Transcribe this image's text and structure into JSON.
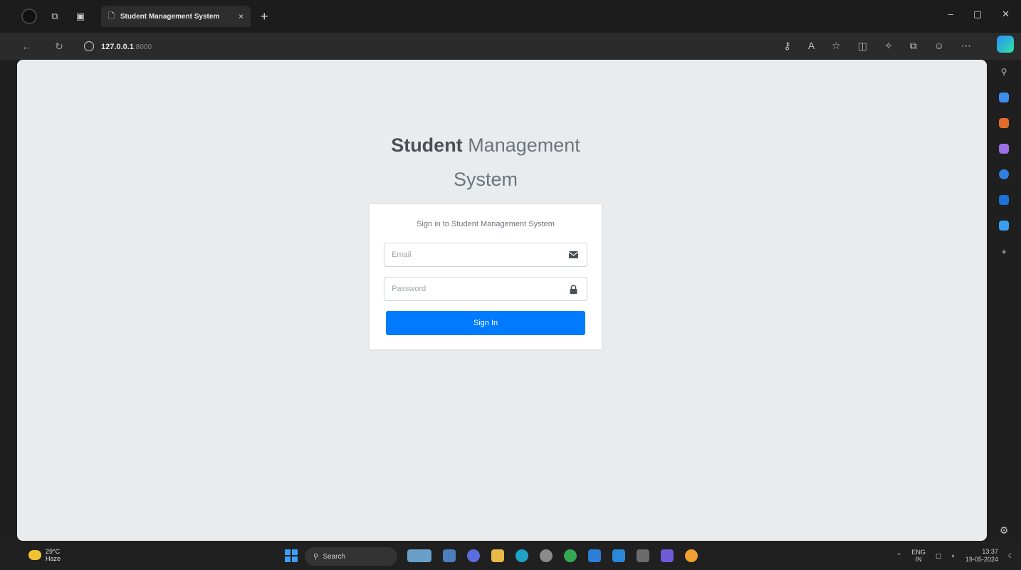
{
  "browser": {
    "tab_title": "Student Management System",
    "tab_close": "×",
    "new_tab": "+",
    "url_host": "127.0.0.1",
    "url_port": ":8000",
    "window_controls": {
      "minimize": "–",
      "maximize": "▢",
      "close": "✕"
    }
  },
  "login": {
    "logo_bold": "Student",
    "logo_rest": " Management System",
    "message": "Sign in to Student Management System",
    "email_placeholder": "Email",
    "password_placeholder": "Password",
    "signin_label": "Sign In"
  },
  "taskbar": {
    "weather_temp": "29°C",
    "weather_desc": "Haze",
    "search_label": "Search",
    "lang_top": "ENG",
    "lang_bottom": "IN",
    "time": "13:37",
    "date": "19-05-2024"
  },
  "colors": {
    "primary": "#007bff",
    "page_bg": "#e9ecef"
  },
  "icons": {
    "email_addon": "envelope-icon",
    "password_addon": "lock-icon"
  }
}
